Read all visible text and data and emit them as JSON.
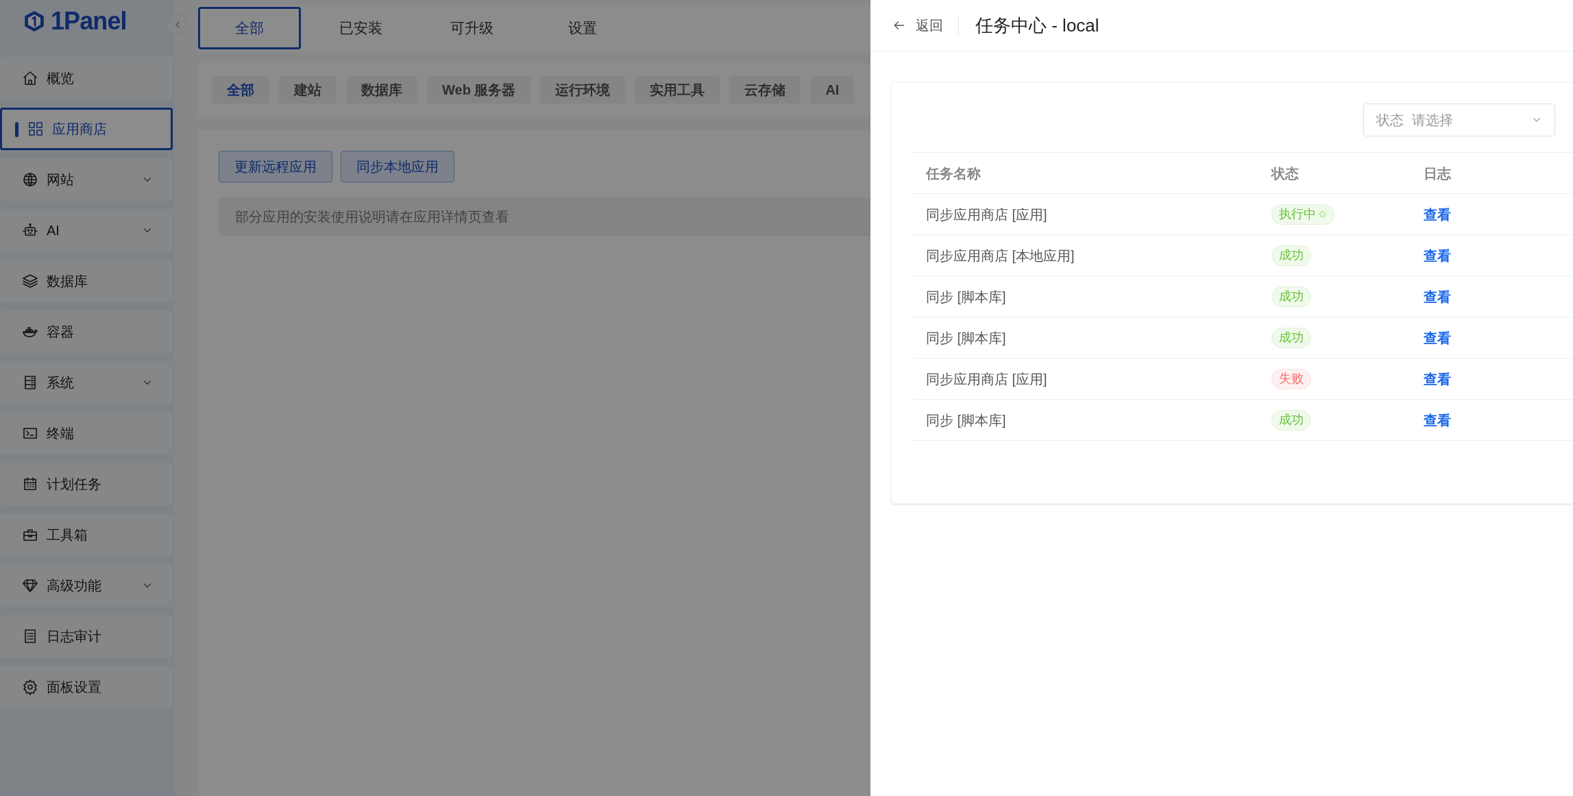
{
  "sidebar": {
    "logo": "1Panel",
    "items": [
      {
        "label": "概览",
        "selected": false,
        "expandable": false
      },
      {
        "label": "应用商店",
        "selected": true,
        "expandable": false
      },
      {
        "label": "网站",
        "selected": false,
        "expandable": true
      },
      {
        "label": "AI",
        "selected": false,
        "expandable": true
      },
      {
        "label": "数据库",
        "selected": false,
        "expandable": false
      },
      {
        "label": "容器",
        "selected": false,
        "expandable": false
      },
      {
        "label": "系统",
        "selected": false,
        "expandable": true
      },
      {
        "label": "终端",
        "selected": false,
        "expandable": false
      },
      {
        "label": "计划任务",
        "selected": false,
        "expandable": false
      },
      {
        "label": "工具箱",
        "selected": false,
        "expandable": false
      },
      {
        "label": "高级功能",
        "selected": false,
        "expandable": true
      },
      {
        "label": "日志审计",
        "selected": false,
        "expandable": false
      },
      {
        "label": "面板设置",
        "selected": false,
        "expandable": false
      }
    ]
  },
  "tabs": [
    {
      "label": "全部",
      "selected": true
    },
    {
      "label": "已安装",
      "selected": false
    },
    {
      "label": "可升级",
      "selected": false
    },
    {
      "label": "设置",
      "selected": false
    }
  ],
  "categories": [
    {
      "label": "全部",
      "selected": true
    },
    {
      "label": "建站",
      "selected": false
    },
    {
      "label": "数据库",
      "selected": false
    },
    {
      "label": "Web 服务器",
      "selected": false
    },
    {
      "label": "运行环境",
      "selected": false
    },
    {
      "label": "实用工具",
      "selected": false
    },
    {
      "label": "云存储",
      "selected": false
    },
    {
      "label": "AI",
      "selected": false
    }
  ],
  "actions": [
    "更新远程应用",
    "同步本地应用"
  ],
  "notice": "部分应用的安装使用说明请在应用详情页查看",
  "drawer": {
    "back": "返回",
    "title": "任务中心 - local",
    "filter": {
      "label": "状态",
      "placeholder": "请选择"
    },
    "columns": [
      "任务名称",
      "状态",
      "日志"
    ],
    "rows": [
      {
        "name": "同步应用商店 [应用]",
        "status": "执行中",
        "kind": "running",
        "log": "查看"
      },
      {
        "name": "同步应用商店 [本地应用]",
        "status": "成功",
        "kind": "success",
        "log": "查看"
      },
      {
        "name": "同步 [脚本库]",
        "status": "成功",
        "kind": "success",
        "log": "查看"
      },
      {
        "name": "同步 [脚本库]",
        "status": "成功",
        "kind": "success",
        "log": "查看"
      },
      {
        "name": "同步应用商店 [应用]",
        "status": "失败",
        "kind": "failed",
        "log": "查看"
      },
      {
        "name": "同步 [脚本库]",
        "status": "成功",
        "kind": "success",
        "log": "查看"
      }
    ]
  }
}
